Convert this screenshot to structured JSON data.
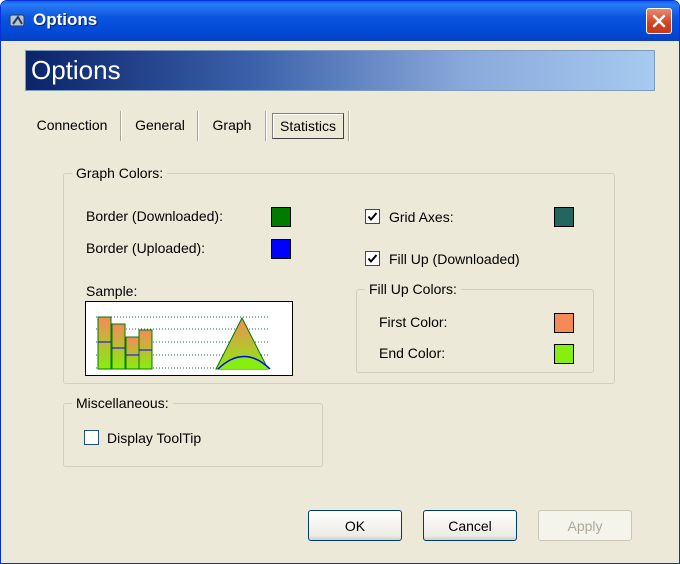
{
  "window": {
    "title": "Options"
  },
  "banner": {
    "title": "Options"
  },
  "tabs": [
    {
      "label": "Connection"
    },
    {
      "label": "General"
    },
    {
      "label": "Graph"
    },
    {
      "label": "Statistics",
      "selected": true
    }
  ],
  "graph_colors": {
    "legend": "Graph Colors:",
    "border_downloaded": {
      "label": "Border (Downloaded):",
      "color": "#007a00"
    },
    "border_uploaded": {
      "label": "Border (Uploaded):",
      "color": "#0000ff"
    },
    "grid_axes": {
      "label": "Grid Axes:",
      "checked": true,
      "color": "#22665e"
    },
    "fill_up_downloaded": {
      "label": "Fill Up (Downloaded)",
      "checked": true
    },
    "sample_label": "Sample:",
    "fill_up_colors": {
      "legend": "Fill Up Colors:",
      "first_color": {
        "label": "First Color:",
        "color": "#f48a58"
      },
      "end_color": {
        "label": "End Color:",
        "color": "#86ef10"
      }
    }
  },
  "miscellaneous": {
    "legend": "Miscellaneous:",
    "display_tooltip": {
      "label": "Display ToolTip",
      "checked": false
    }
  },
  "buttons": {
    "ok": "OK",
    "cancel": "Cancel",
    "apply": "Apply"
  }
}
